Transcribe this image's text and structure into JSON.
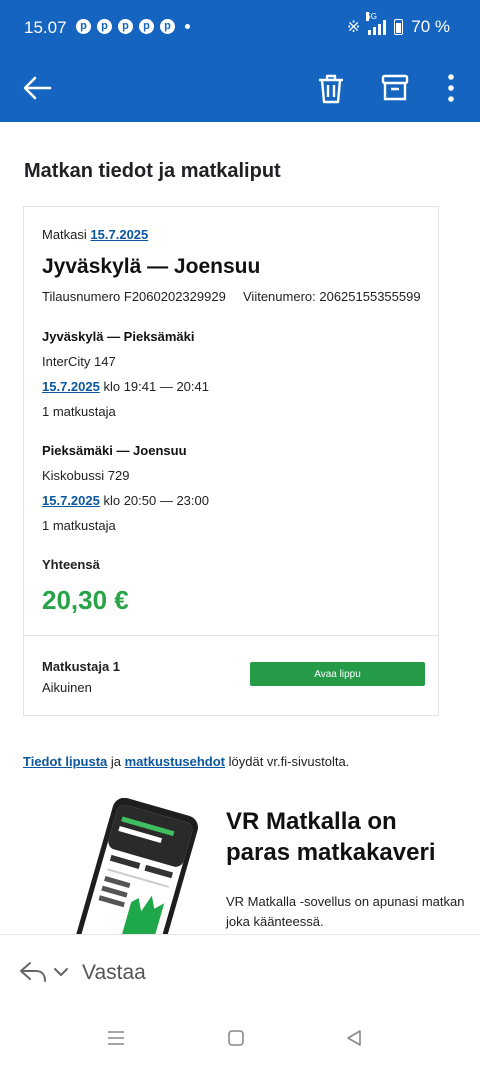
{
  "status_bar": {
    "time": "15.07",
    "network": "5G",
    "battery": "70 %"
  },
  "toolbar": {
    "back_icon": "arrow-left-icon",
    "delete_icon": "trash-icon",
    "archive_icon": "archive-icon",
    "more_icon": "more-vertical-icon"
  },
  "email": {
    "title": "Matkan tiedot ja matkaliput",
    "trip": {
      "date_prefix": "Matkasi",
      "date": "15.7.2025",
      "route": "Jyväskylä — Joensuu",
      "order_number": "Tilausnumero F2060202329929",
      "reference_number": "Viitenumero: 20625155355599"
    },
    "legs": [
      {
        "route": "Jyväskylä — Pieksämäki",
        "train": "InterCity 147",
        "date": "15.7.2025",
        "time": "klo 19:41 — 20:41",
        "passengers": "1 matkustaja"
      },
      {
        "route": "Pieksämäki — Joensuu",
        "train": "Kiskobussi 729",
        "date": "15.7.2025",
        "time": "klo 20:50 — 23:00",
        "passengers": "1 matkustaja"
      }
    ],
    "total_label": "Yhteensä",
    "total_price": "20,30 €",
    "passenger": {
      "title": "Matkustaja 1",
      "type": "Aikuinen",
      "button": "Avaa lippu"
    },
    "footer": {
      "link1": "Tiedot lipusta",
      "and": " ja ",
      "link2": "matkustusehdot",
      "rest": " löydät vr.fi-sivustolta."
    },
    "promo": {
      "title": "VR Matkalla on paras matkakaveri",
      "text": "VR Matkalla -sovellus on apunasi matkan joka käänteessä."
    }
  },
  "reply": {
    "label": "Vastaa"
  },
  "colors": {
    "brand_blue": "#1565c0",
    "price_green": "#27a348",
    "button_green": "#259a47",
    "link_blue": "#0b57a0"
  }
}
